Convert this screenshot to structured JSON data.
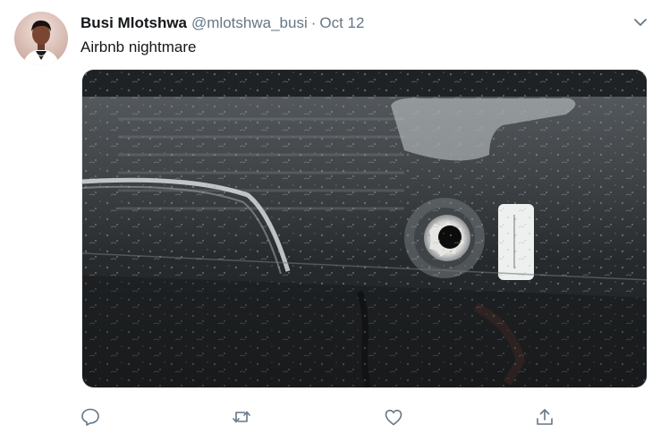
{
  "tweet": {
    "display_name": "Busi Mlotshwa",
    "handle": "@mlotshwa_busi",
    "separator": "·",
    "date": "Oct 12",
    "text": "Airbnb nightmare"
  },
  "icons": {
    "more": "chevron-down-icon",
    "reply": "comment-icon",
    "retweet": "retweet-icon",
    "like": "heart-icon",
    "share": "share-icon"
  },
  "colors": {
    "icon_gray": "#657786",
    "text_primary": "#14171a",
    "text_secondary": "#657786",
    "border": "#e1e8ed"
  }
}
